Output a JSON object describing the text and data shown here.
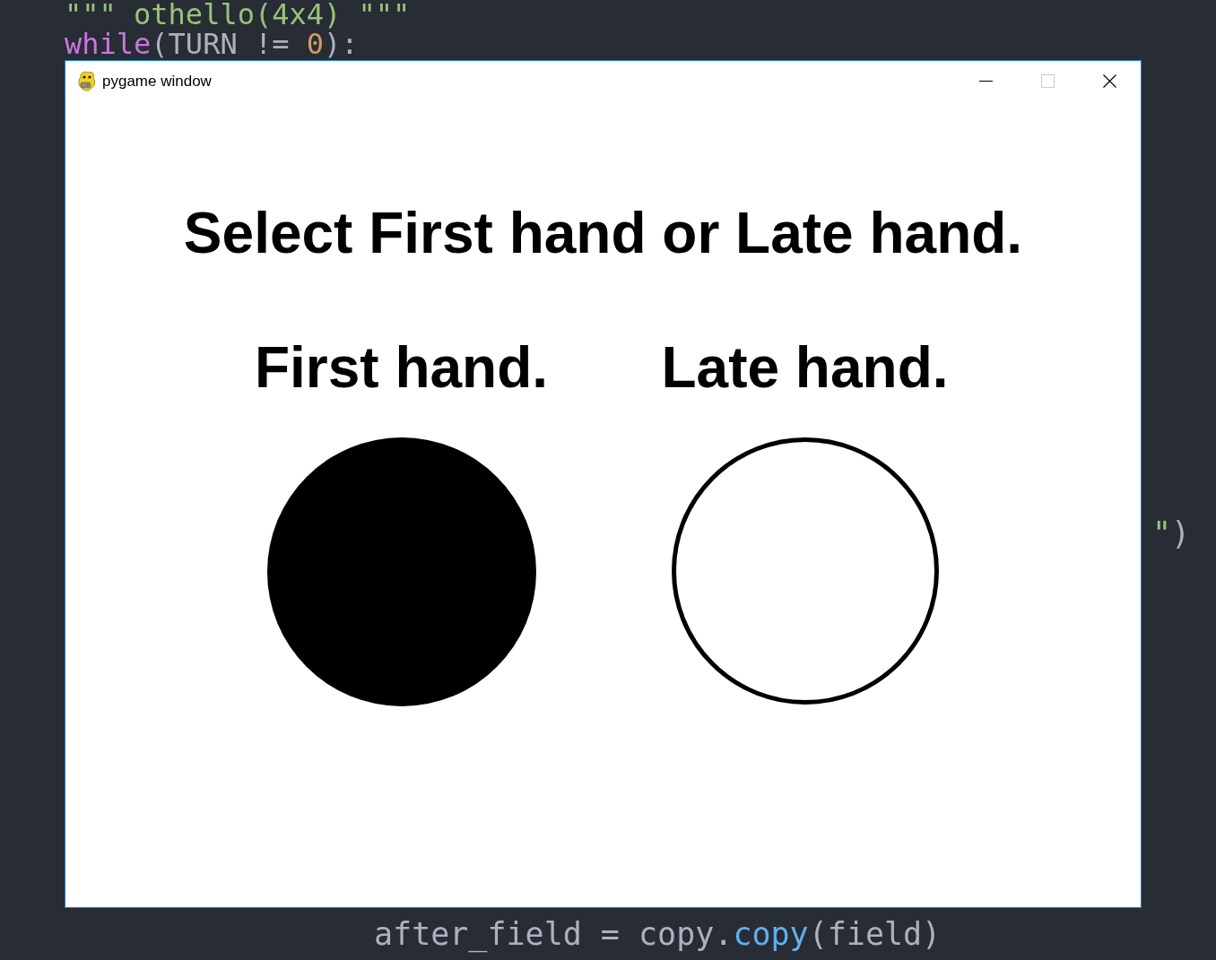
{
  "editor": {
    "lines_above": [
      {
        "tokens": [
          {
            "kind": "string",
            "text": "\"\"\" othello(4x4) \"\"\""
          }
        ]
      },
      {
        "tokens": [
          {
            "kind": "keyword",
            "text": "while"
          },
          {
            "kind": "plain",
            "text": "(TURN != "
          },
          {
            "kind": "number",
            "text": "0"
          },
          {
            "kind": "plain",
            "text": "):"
          }
        ]
      }
    ],
    "line_beside": {
      "tokens": [
        {
          "kind": "string",
          "text": "\""
        },
        {
          "kind": "plain",
          "text": ")"
        }
      ]
    },
    "line_below": {
      "tokens": [
        {
          "kind": "plain",
          "text": "after_field = copy."
        },
        {
          "kind": "function",
          "text": "copy"
        },
        {
          "kind": "plain",
          "text": "(field)"
        }
      ]
    }
  },
  "window": {
    "title": "pygame window",
    "focused": true,
    "controls": [
      {
        "kind": "minimize",
        "disabled": false
      },
      {
        "kind": "maximize",
        "disabled": true
      },
      {
        "kind": "close",
        "disabled": false
      }
    ]
  },
  "game": {
    "heading": "Select First hand or Late hand.",
    "options": [
      {
        "label": "First hand.",
        "kind": "filled"
      },
      {
        "label": "Late hand.",
        "kind": "hollow"
      }
    ]
  }
}
